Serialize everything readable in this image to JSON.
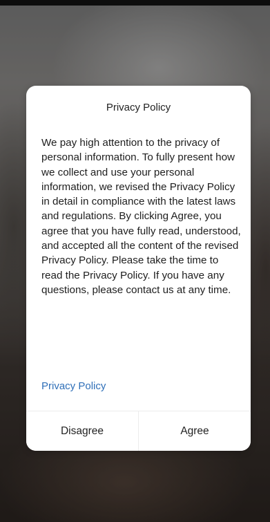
{
  "dialog": {
    "title": "Privacy Policy",
    "body": "We pay high attention to the privacy of personal information. To fully present how we collect and use your personal information, we revised the Privacy Policy in detail in compliance with the latest laws and regulations. By clicking Agree, you agree that you have fully read, understood, and accepted all the content of the revised Privacy Policy. Please take the time to read the Privacy Policy. If you have any questions, please contact us at any time.",
    "link_label": "Privacy Policy",
    "disagree_label": "Disagree",
    "agree_label": "Agree"
  },
  "colors": {
    "link": "#2f6fb8",
    "dialog_background": "#ffffff",
    "text": "#1e1e1e"
  }
}
